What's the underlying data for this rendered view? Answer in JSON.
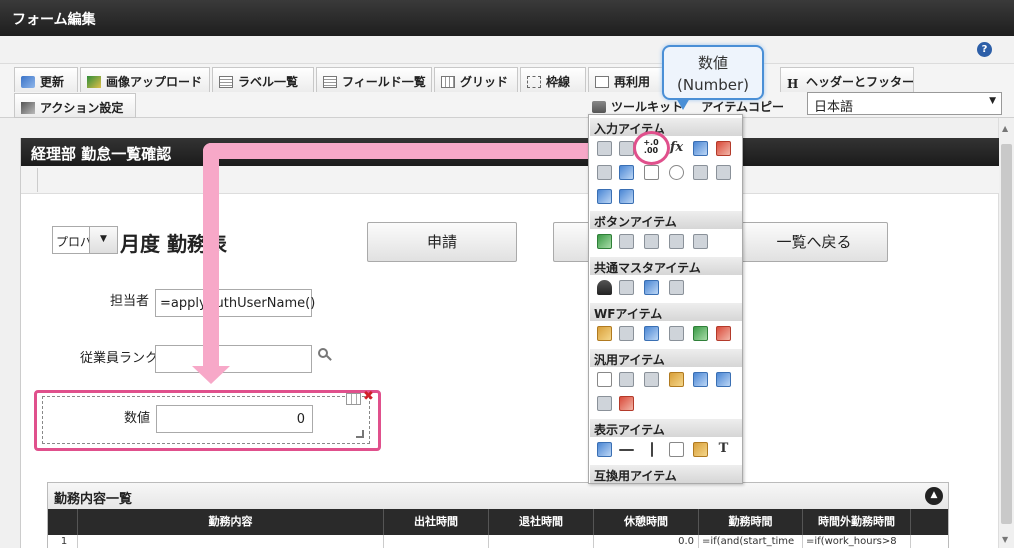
{
  "window": {
    "title": "フォーム編集",
    "help": "?"
  },
  "toolbar": {
    "update": "更新",
    "image_upload": "画像アップロード",
    "label_list": "ラベル一覧",
    "field_list": "フィールド一覧",
    "grid": "グリッド",
    "frame": "枠線",
    "reuse": "再利用",
    "header_footer": "ヘッダーとフッター",
    "action_settings": "アクション設定",
    "toolkit": "ツールキット",
    "item_copy": "アイテムコピー",
    "language": "日本語"
  },
  "form": {
    "header": "経理部 勤怠一覧確認",
    "select_value": "プロパ",
    "month_title": "月度 勤務表",
    "apply_button": "申請",
    "back_button": "一覧へ戻る",
    "person_label": "担当者",
    "person_value": "=applyAuthUserName()",
    "rank_label": "従業員ランク",
    "number_label": "数値",
    "number_value": "0"
  },
  "list": {
    "title": "勤務内容一覧",
    "columns": [
      "勤務内容",
      "出社時間",
      "退社時間",
      "休憩時間",
      "勤務時間",
      "時間外勤務時間"
    ],
    "first_row": {
      "index": "1",
      "rest": "0.0",
      "work": "=if(and(start_time",
      "overtime": "=if(work_hours>8"
    }
  },
  "palette": {
    "sections": [
      "入力アイテム",
      "ボタンアイテム",
      "共通マスタアイテム",
      "WFアイテム",
      "汎用アイテム",
      "表示アイテム",
      "互換用アイテム"
    ],
    "number_glyph_top": "+.0",
    "number_glyph_bottom": ".00",
    "formula_glyph": "fx",
    "text_glyph": "T"
  },
  "tooltip": {
    "line1": "数値",
    "line2": "(Number)"
  },
  "colors": {
    "highlight": "#e0508c",
    "arrow": "#f7a8c8",
    "tooltip_border": "#4a8fd6"
  }
}
